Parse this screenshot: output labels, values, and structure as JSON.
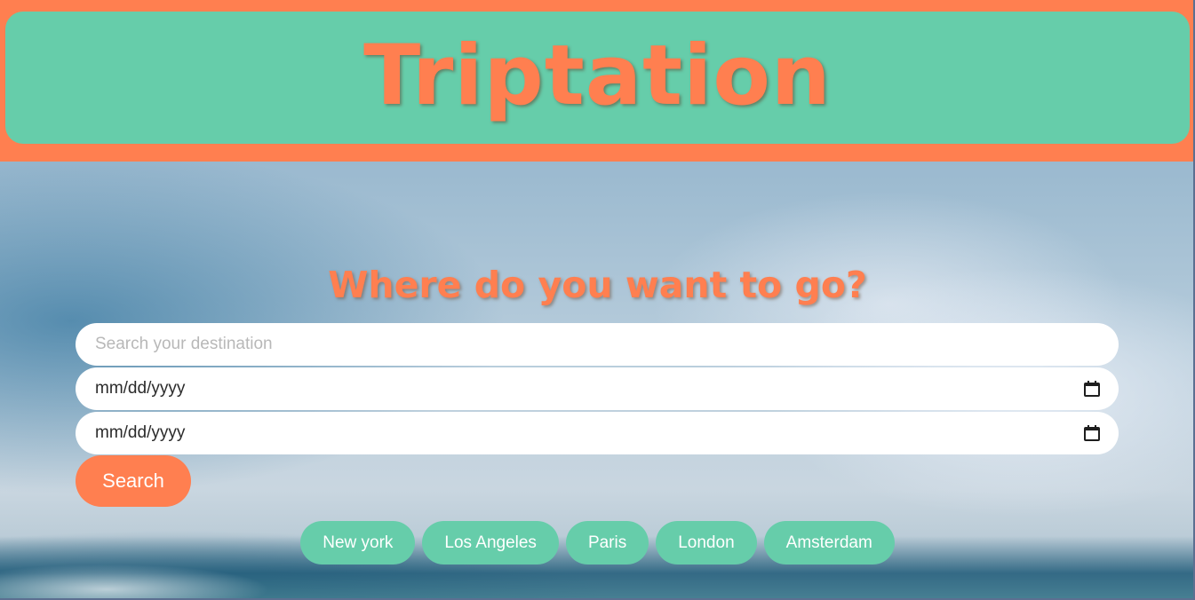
{
  "app": {
    "title": "Triptation"
  },
  "hero": {
    "title": "Where do you want to go?"
  },
  "search": {
    "placeholder": "Search your destination",
    "value": ""
  },
  "dates": [
    {
      "value": "mm/dd/yyyy",
      "icon": "calendar-icon"
    },
    {
      "value": "mm/dd/yyyy",
      "icon": "calendar-icon"
    }
  ],
  "actions": {
    "search_label": "Search"
  },
  "destinations": [
    "New york",
    "Los Angeles",
    "Paris",
    "London",
    "Amsterdam"
  ],
  "colors": {
    "primary": "#ff7f50",
    "secondary": "#66cdaa",
    "input_bg": "#ffffff",
    "text_light": "#ffffff"
  }
}
